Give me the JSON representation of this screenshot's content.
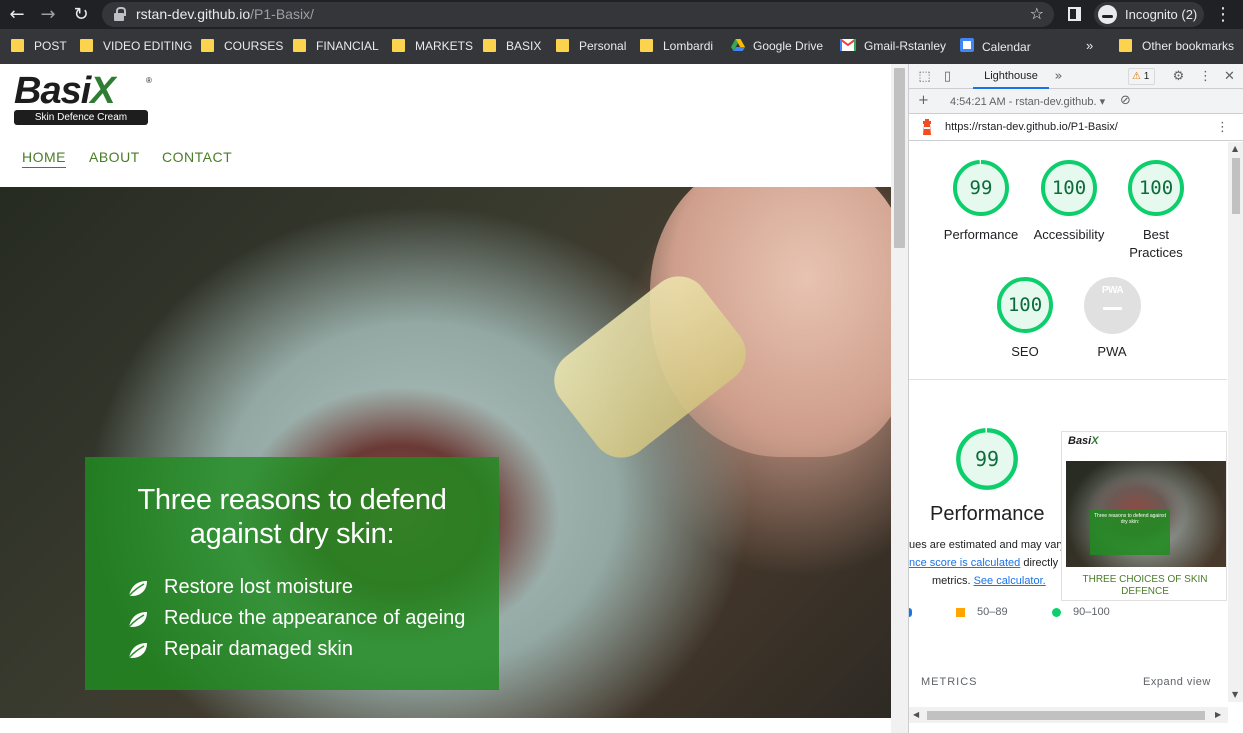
{
  "browser": {
    "url_host": "rstan-dev.github.io",
    "url_path": "/P1-Basix/",
    "profile_label": "Incognito (2)"
  },
  "bookmarks": [
    {
      "label": "POST",
      "icon": "folder-icon"
    },
    {
      "label": "VIDEO EDITING",
      "icon": "folder-icon"
    },
    {
      "label": "COURSES",
      "icon": "folder-icon"
    },
    {
      "label": "FINANCIAL",
      "icon": "folder-icon"
    },
    {
      "label": "MARKETS",
      "icon": "folder-icon"
    },
    {
      "label": "BASIX",
      "icon": "folder-icon"
    },
    {
      "label": "Personal",
      "icon": "folder-icon"
    },
    {
      "label": "Lombardi",
      "icon": "folder-icon"
    },
    {
      "label": "Google Drive",
      "icon": "google-drive-icon"
    },
    {
      "label": "Gmail-Rstanley",
      "icon": "gmail-icon"
    },
    {
      "label": "Calendar",
      "icon": "calendar-icon"
    }
  ],
  "bookmarks_overflow": "»",
  "other_bookmarks": "Other bookmarks",
  "site": {
    "logo_text": "BasiX",
    "logo_tagline": "Skin Defence Cream",
    "logo_reg": "®",
    "nav": [
      "HOME",
      "ABOUT",
      "CONTACT"
    ],
    "hero_title_line1": "Three reasons to defend",
    "hero_title_line2": "against dry skin:",
    "hero_items": [
      "Restore lost moisture",
      "Reduce the appearance of ageing",
      "Repair damaged skin"
    ]
  },
  "devtools": {
    "tab_label": "Lighthouse",
    "more_tabs": "»",
    "warning_count": "1",
    "report_selector": "4:54:21 AM - rstan-dev.github.",
    "report_url": "https://rstan-dev.github.io/P1-Basix/",
    "scores": [
      {
        "label": "Performance",
        "value": 99
      },
      {
        "label": "Accessibility",
        "value": 100
      },
      {
        "label": "Best Practices",
        "value": 100
      },
      {
        "label": "SEO",
        "value": 100
      }
    ],
    "pwa_label": "PWA",
    "pwa_badge": "PWA",
    "perf_big_score": 99,
    "perf_big_label": "Performance",
    "note_line1": "ues are estimated and may vary. T",
    "note_line2_link": "nce score is calculated",
    "note_line2_rest": " directly fr",
    "note_line3_pre": "metrics. ",
    "note_line3_link": "See calculator.",
    "thumb_title": "Three reasons to defend against dry skin:",
    "thumb_caption": "THREE CHOICES OF SKIN DEFENCE",
    "legend_mid": "50–89",
    "legend_high": "90–100",
    "metrics_heading": "METRICS",
    "expand_label": "Expand view",
    "colors": {
      "pass": "#0cce6b",
      "average": "#ffa400",
      "accent": "#1a73e8"
    }
  }
}
